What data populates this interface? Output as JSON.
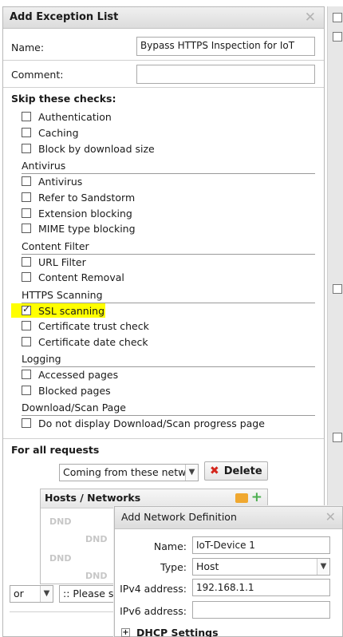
{
  "dialog": {
    "title": "Add Exception List",
    "close_icon": "close-icon",
    "name_label": "Name:",
    "name_value": "Bypass HTTPS Inspection for IoT",
    "comment_label": "Comment:",
    "comment_value": ""
  },
  "skip_checks": {
    "title": "Skip these checks:",
    "general": [
      {
        "label": "Authentication",
        "checked": false
      },
      {
        "label": "Caching",
        "checked": false
      },
      {
        "label": "Block by download size",
        "checked": false
      }
    ],
    "groups": [
      {
        "header": "Antivirus",
        "items": [
          {
            "label": "Antivirus",
            "checked": false
          },
          {
            "label": "Refer to Sandstorm",
            "checked": false
          },
          {
            "label": "Extension blocking",
            "checked": false
          },
          {
            "label": "MIME type blocking",
            "checked": false
          }
        ]
      },
      {
        "header": "Content Filter",
        "items": [
          {
            "label": "URL Filter",
            "checked": false
          },
          {
            "label": "Content Removal",
            "checked": false
          }
        ]
      },
      {
        "header": "HTTPS Scanning",
        "items": [
          {
            "label": "SSL scanning",
            "checked": true
          },
          {
            "label": "Certificate trust check",
            "checked": false
          },
          {
            "label": "Certificate date check",
            "checked": false
          }
        ]
      },
      {
        "header": "Logging",
        "items": [
          {
            "label": "Accessed pages",
            "checked": false
          },
          {
            "label": "Blocked pages",
            "checked": false
          }
        ]
      },
      {
        "header": "Download/Scan Page",
        "items": [
          {
            "label": "Do not display Download/Scan progress page",
            "checked": false
          }
        ]
      }
    ]
  },
  "requests": {
    "title": "For all requests",
    "source_select": "Coming from these networ",
    "delete_label": "Delete",
    "hosts_header": "Hosts / Networks",
    "dnd": [
      "DND",
      "DND",
      "DND",
      "DND"
    ],
    "or_select": "or",
    "please_select": ":: Please se"
  },
  "net_dialog": {
    "title": "Add Network Definition",
    "name_label": "Name:",
    "name_value": "IoT-Device 1",
    "type_label": "Type:",
    "type_value": "Host",
    "ipv4_label": "IPv4 address:",
    "ipv4_value": "192.168.1.1",
    "ipv6_label": "IPv6 address:",
    "ipv6_value": "",
    "dhcp_label": "DHCP Settings"
  }
}
